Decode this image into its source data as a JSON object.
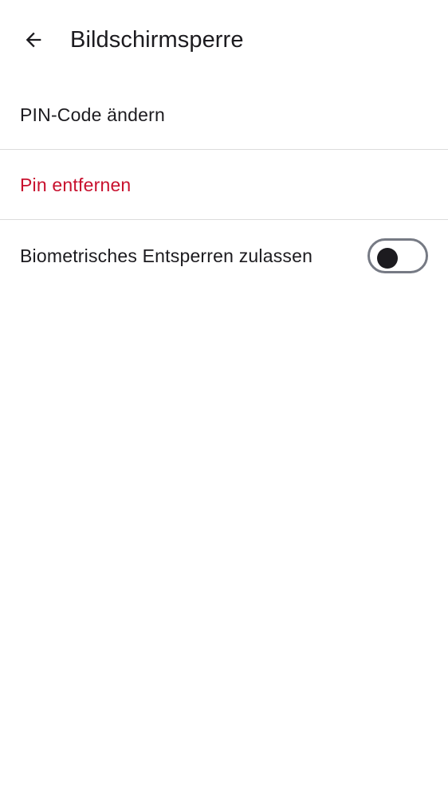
{
  "app_bar": {
    "back_icon": "arrow-left-icon",
    "title": "Bildschirmsperre"
  },
  "items": [
    {
      "label": "PIN-Code ändern",
      "color": "#1c1b1f"
    },
    {
      "label": "Pin entfernen",
      "color": "#c8102e"
    },
    {
      "label": "Biometrisches Entsperren zulassen",
      "color": "#1c1b1f",
      "toggle": {
        "checked": false
      }
    }
  ],
  "colors": {
    "background": "#ffffff",
    "text": "#1c1b1f",
    "danger": "#c8102e",
    "divider": "#dcdcdc",
    "switch_outline": "#767a84"
  }
}
